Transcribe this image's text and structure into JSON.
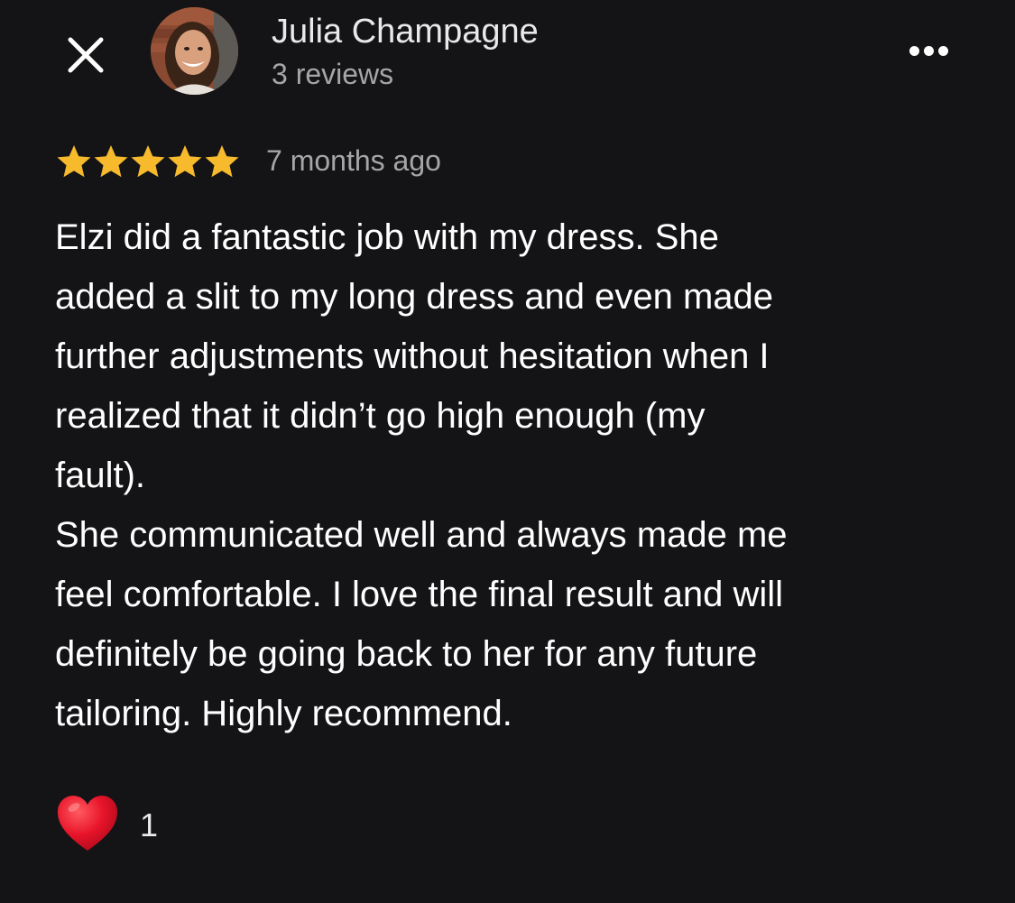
{
  "header": {
    "close_icon": "close-icon",
    "author_name": "Julia Champagne",
    "review_count": "3 reviews",
    "more_icon": "more-horizontal-icon"
  },
  "review": {
    "rating": 5,
    "rating_max": 5,
    "star_color": "#F6BA2C",
    "time_ago": "7 months ago",
    "lines": [
      "Elzi did a fantastic job with my dress. She",
      "added a slit to my long dress and even made",
      "further adjustments without hesitation when I",
      "realized that it didn’t go high enough (my",
      "fault).",
      "She communicated well and always made me",
      "feel comfortable. I love the final result and will",
      "definitely be going back to her for any future",
      "tailoring. Highly recommend."
    ]
  },
  "reactions": {
    "like_icon": "heart-icon",
    "like_count": "1",
    "heart_color": "#E8142A"
  },
  "colors": {
    "background": "#141416",
    "text_primary": "#FFFFFF",
    "text_secondary": "#A6A6AA"
  }
}
